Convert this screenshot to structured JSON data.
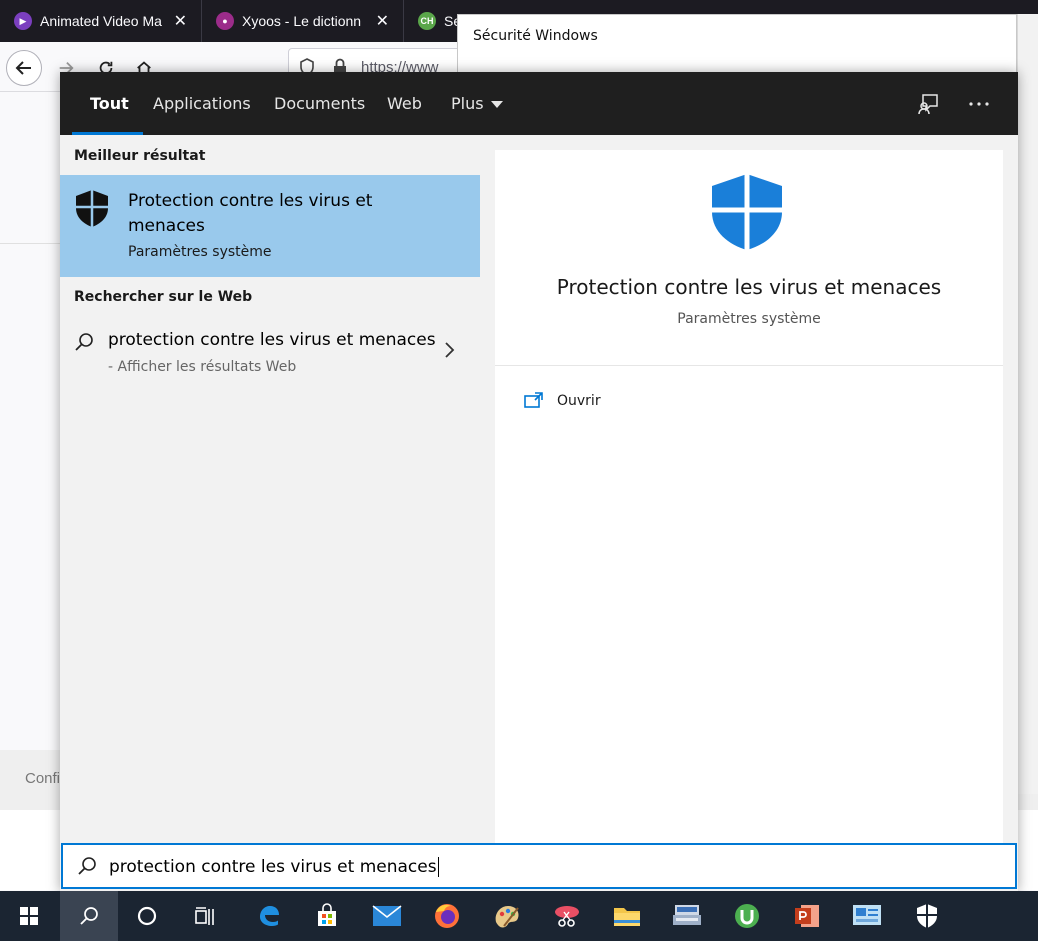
{
  "browser": {
    "tabs": [
      {
        "label": "Animated Video Ma"
      },
      {
        "label": "Xyoos - Le dictionn"
      },
      {
        "label": "Se"
      }
    ],
    "url_text": "https://www",
    "footer_text": "Confi"
  },
  "window": {
    "title": "Sécurité Windows"
  },
  "search_panel": {
    "tabs": {
      "all": "Tout",
      "apps": "Applications",
      "documents": "Documents",
      "web": "Web",
      "more": "Plus"
    },
    "best_match_header": "Meilleur résultat",
    "best_match": {
      "title": "Protection contre les virus et menaces",
      "subtitle": "Paramètres système"
    },
    "web_header": "Rechercher sur le Web",
    "web_result": {
      "query": "protection contre les virus et menaces",
      "hint": "Afficher les résultats Web"
    },
    "detail": {
      "title": "Protection contre les virus et menaces",
      "subtitle": "Paramètres système",
      "actions": [
        {
          "label": "Ouvrir",
          "icon": "open-icon"
        }
      ]
    },
    "search_input": "protection contre les virus et menaces"
  },
  "taskbar": {
    "items": [
      "start-icon",
      "search-icon",
      "cortana-icon",
      "task-view-icon",
      "edge-icon",
      "store-icon",
      "mail-icon",
      "firefox-icon",
      "paint-icon",
      "snipping-icon",
      "file-explorer-icon",
      "scanner-icon",
      "utorrent-icon",
      "powerpoint-icon",
      "control-panel-icon",
      "windows-security-icon"
    ]
  },
  "colors": {
    "accent": "#0078d4",
    "best_match_bg": "#99c9ec",
    "topbar_bg": "#1f1f1f",
    "taskbar_bg": "#1b2532"
  }
}
